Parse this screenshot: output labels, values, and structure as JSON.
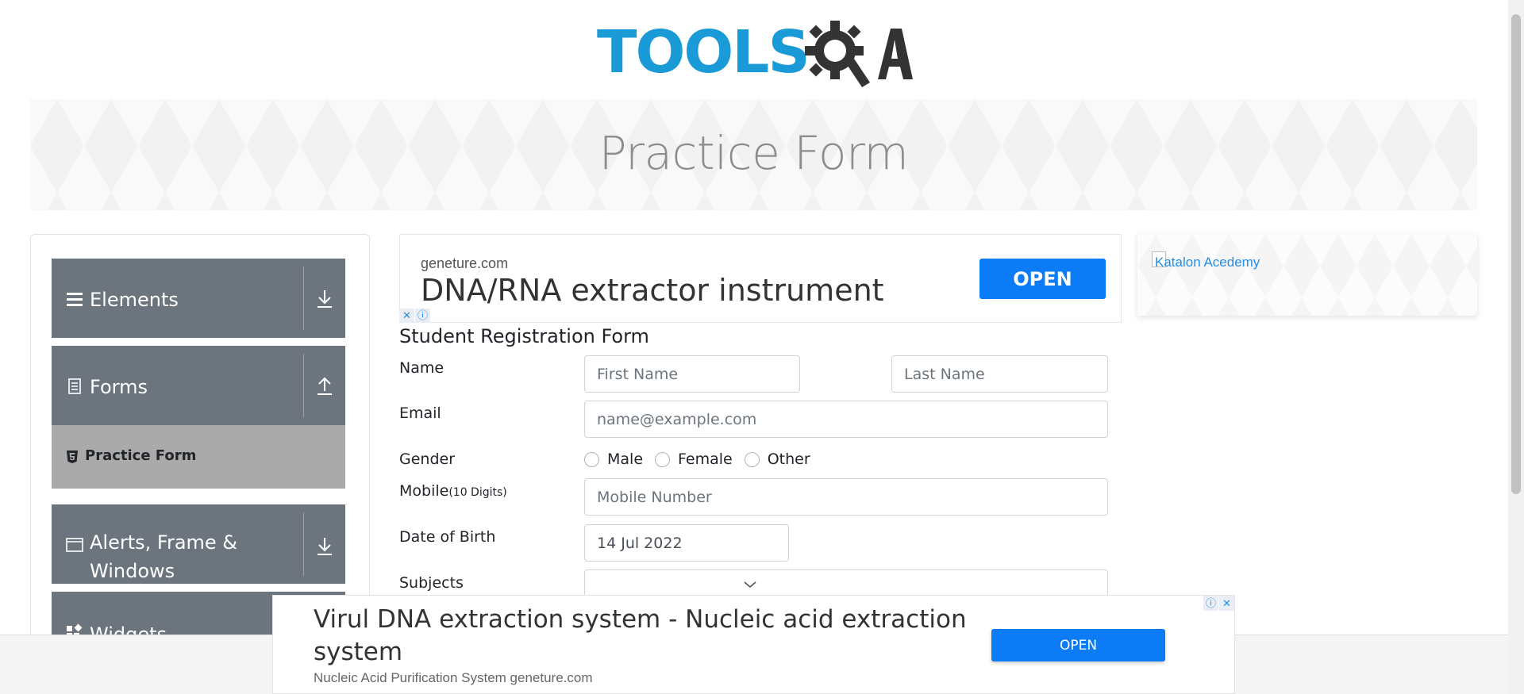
{
  "header": {
    "logo_text": "TOOLS",
    "logo_text_qa": "QA",
    "brand_blue": "#1a9ad6",
    "brand_gray": "#333333"
  },
  "banner": {
    "title": "Practice Form"
  },
  "sidebar": {
    "groups": [
      {
        "label": "Elements",
        "icon": "hamburger-icon",
        "arrow": "download-arrow-icon"
      },
      {
        "label": "Forms",
        "icon": "document-icon",
        "arrow": "upload-arrow-icon"
      },
      {
        "label": "Alerts, Frame & Windows",
        "icon": "window-icon",
        "arrow": "download-arrow-icon"
      },
      {
        "label": "Widgets",
        "icon": "widgets-icon"
      }
    ],
    "active_item": {
      "label": "Practice Form",
      "icon": "html5-icon"
    },
    "group_color": "#6c757d",
    "active_color": "#aaaaaa"
  },
  "ad_top": {
    "domain": "geneture.com",
    "headline": "DNA/RNA extractor instrument",
    "open_label": "OPEN",
    "button_color": "#0b7cf6"
  },
  "right_ad": {
    "alt_text": "Katalon Acedemy"
  },
  "form": {
    "title": "Student Registration Form",
    "name_label": "Name",
    "first_name_placeholder": "First Name",
    "last_name_placeholder": "Last Name",
    "email_label": "Email",
    "email_placeholder": "name@example.com",
    "gender_label": "Gender",
    "gender_options": [
      "Male",
      "Female",
      "Other"
    ],
    "mobile_label": "Mobile",
    "mobile_hint": "(10 Digits)",
    "mobile_placeholder": "Mobile Number",
    "dob_label": "Date of Birth",
    "dob_value": "14 Jul 2022",
    "subjects_label": "Subjects"
  },
  "ad_bottom": {
    "headline": "Virul DNA extraction system - Nucleic acid extraction system",
    "subline": "Nucleic Acid Purification System geneture.com",
    "open_label": "OPEN"
  }
}
